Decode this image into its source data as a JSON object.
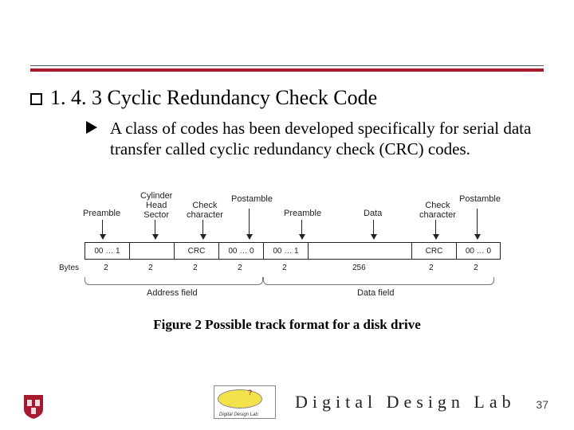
{
  "heading": "1. 4. 3 Cyclic Redundancy Check Code",
  "body": "A class of codes has been developed specifically for serial data transfer called cyclic redundancy check (CRC) codes.",
  "caption": "Figure 2 Possible track format for a disk drive",
  "figure": {
    "labels": {
      "preamble1": "Preamble",
      "chs": "Cylinder\nHead\nSector",
      "chk1": "Check\ncharacter",
      "post1": "Postamble",
      "preamble2": "Preamble",
      "data": "Data",
      "chk2": "Check\ncharacter",
      "post2": "Postamble"
    },
    "cells": {
      "c1": "00 … 1",
      "c2": "",
      "c3": "CRC",
      "c4": "00 … 0",
      "c5": "00 … 1",
      "c6": "",
      "c7": "CRC",
      "c8": "00 … 0"
    },
    "bytes_label": "Bytes",
    "bytes": {
      "b1": "2",
      "b2": "2",
      "b3": "2",
      "b4": "2",
      "b5": "2",
      "b6": "256",
      "b7": "2",
      "b8": "2"
    },
    "braces": {
      "addr": "Address field",
      "data": "Data field"
    }
  },
  "footer": {
    "lab_text": "Digital Design Lab",
    "page_number": "37",
    "logo_caption": "Digital Design Lab",
    "logo_mark": "?"
  }
}
